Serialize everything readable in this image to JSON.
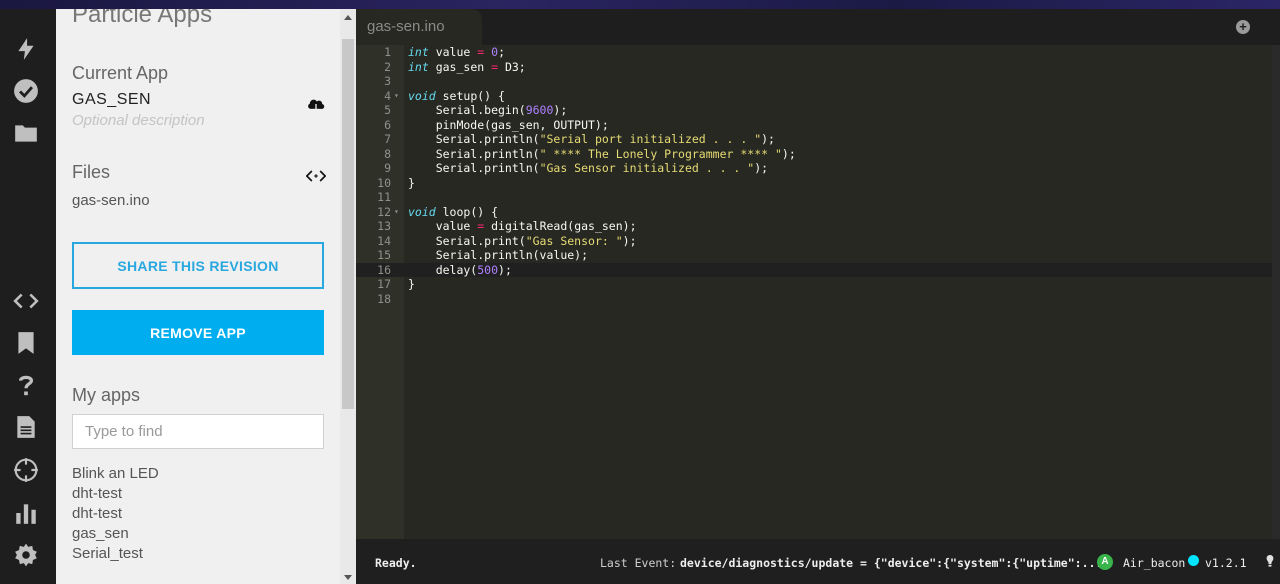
{
  "panel": {
    "title": "Particle Apps",
    "current_app_heading": "Current App",
    "app_name": "GAS_SEN",
    "description_placeholder": "Optional description",
    "files_heading": "Files",
    "file_name": "gas-sen.ino",
    "share_button": "SHARE THIS REVISION",
    "remove_button": "REMOVE APP",
    "my_apps_heading": "My apps",
    "search_placeholder": "Type to find",
    "apps": [
      "Blink an LED",
      "dht-test",
      "dht-test",
      "gas_sen",
      "Serial_test"
    ]
  },
  "rail_icons": [
    "flash-icon",
    "verify-icon",
    "folder-icon",
    "code-icon",
    "bookmark-icon",
    "help-icon",
    "docs-icon",
    "target-icon",
    "console-icon",
    "settings-icon"
  ],
  "editor": {
    "tab_label": "gas-sen.ino",
    "add_tab_symbol": "+",
    "active_line": 16,
    "lines": [
      "int value = 0;",
      "int gas_sen = D3;",
      "",
      "void setup() {",
      "    Serial.begin(9600);",
      "    pinMode(gas_sen, OUTPUT);",
      "    Serial.println(\"Serial port initialized . . . \");",
      "    Serial.println(\" **** The Lonely Programmer **** \");",
      "    Serial.println(\"Gas Sensor initialized . . . \");",
      "}",
      "",
      "void loop() {",
      "    value = digitalRead(gas_sen);",
      "    Serial.print(\"Gas Sensor: \");",
      "    Serial.println(value);",
      "    delay(500);",
      "}",
      ""
    ],
    "fold_lines": [
      4,
      12
    ]
  },
  "status": {
    "ready": "Ready.",
    "last_event_label": "Last Event:",
    "last_event": "device/diagnostics/update = {\"device\":{\"system\":{\"uptime\":...",
    "device_badge": "A",
    "device_name": "Air_bacon",
    "device_status_color": "#00e5ff",
    "firmware": "v1.2.1"
  },
  "colors": {
    "accent": "#00aeef",
    "editor_bg": "#272822",
    "panel_bg": "#f0f0f0"
  }
}
